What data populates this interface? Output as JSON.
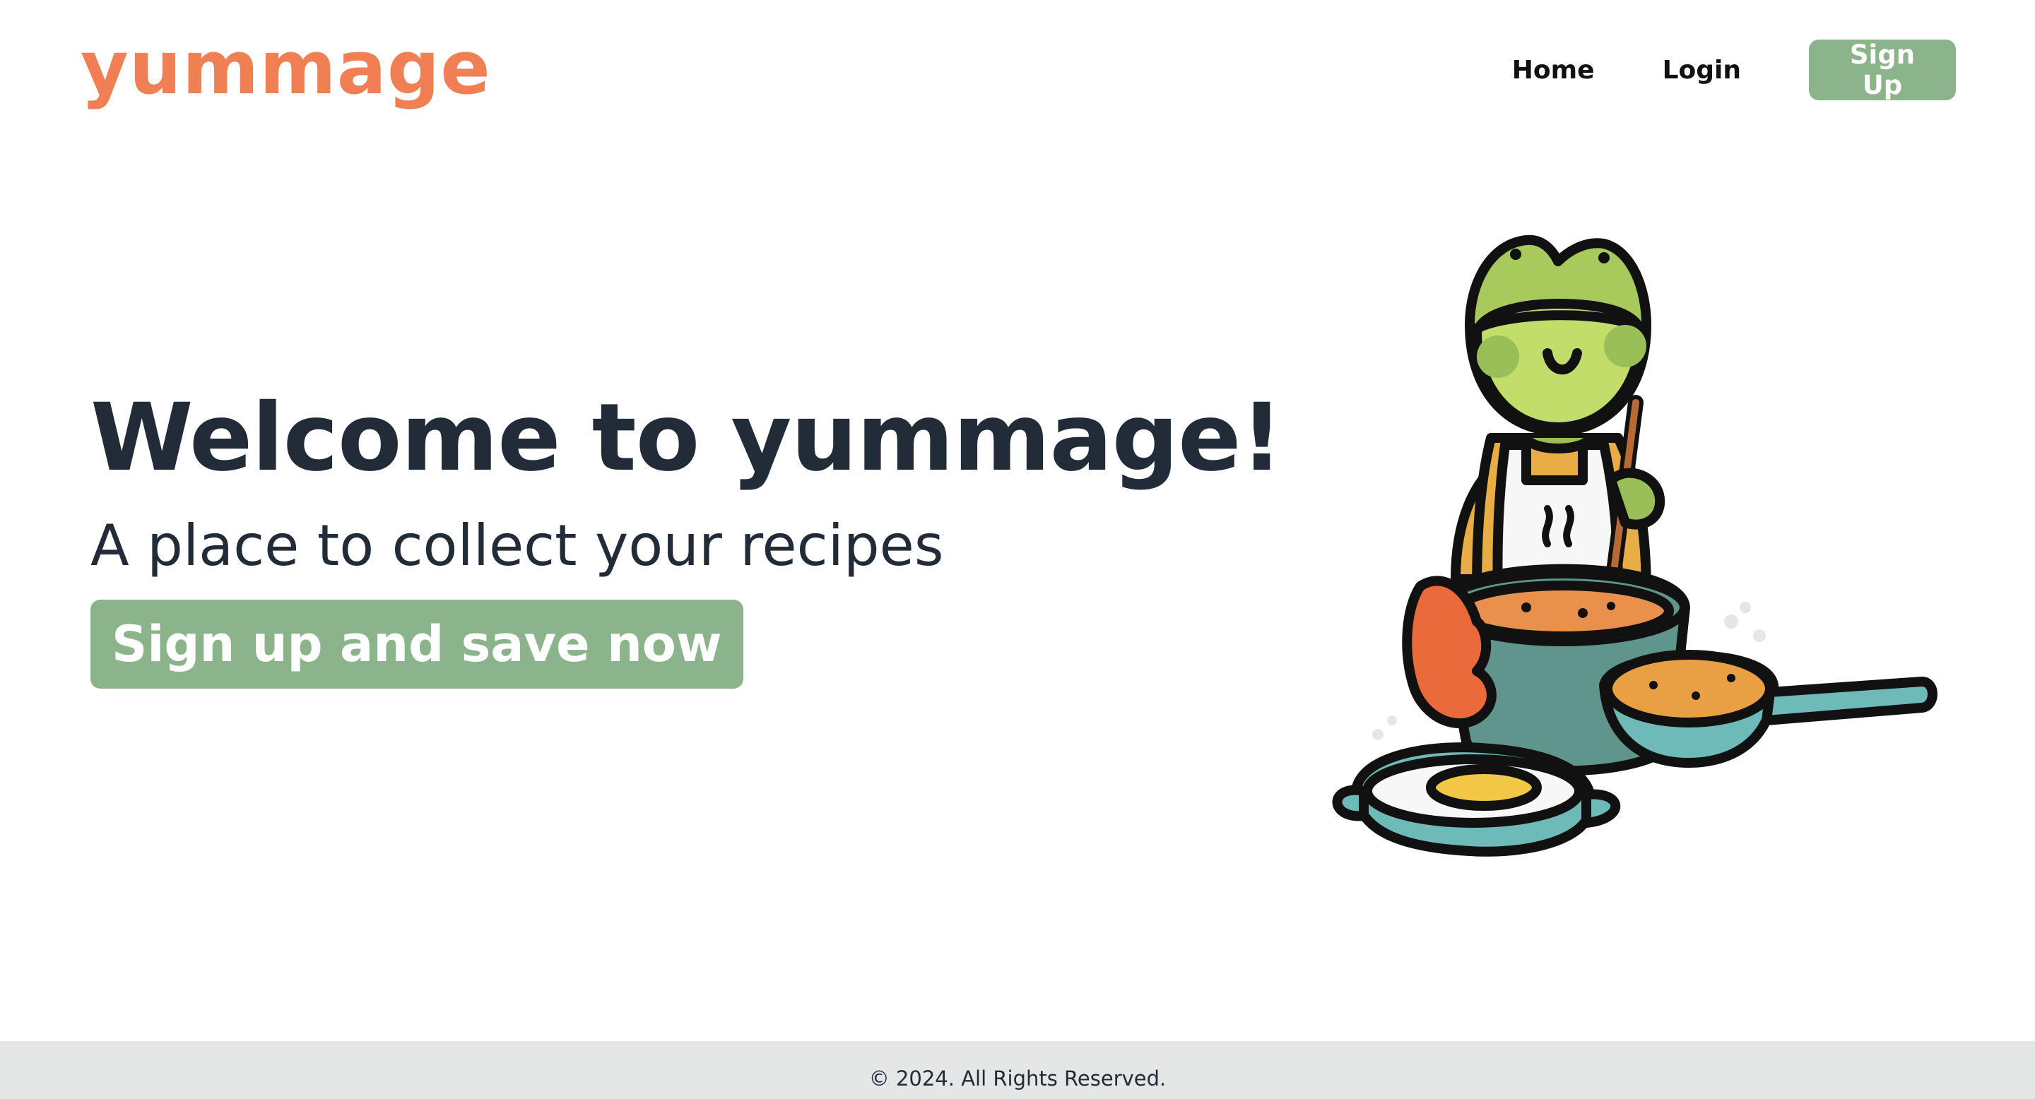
{
  "brand": {
    "logo_text": "yummage",
    "accent_color": "#f07f53",
    "button_color": "#8cb48a"
  },
  "nav": {
    "home_label": "Home",
    "login_label": "Login",
    "signup_label": "Sign Up"
  },
  "hero": {
    "title": "Welcome to yummage!",
    "subtitle": "A place to collect your recipes",
    "cta_label": "Sign up and save now",
    "illustration_icon": "frog-chef-cooking-illustration"
  },
  "footer": {
    "copyright": "© 2024. All Rights Reserved."
  }
}
